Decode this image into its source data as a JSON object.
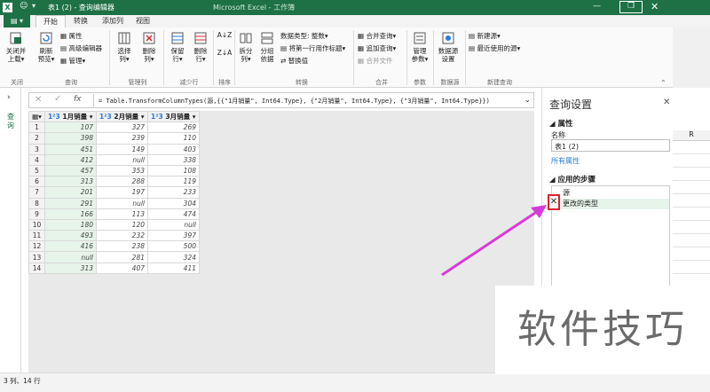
{
  "window": {
    "title": "表1 (2) - 查询编辑器",
    "excel_title": "Microsoft Excel - 工作簿"
  },
  "file_tab": "▾",
  "tabs": [
    "开始",
    "转换",
    "添加列",
    "视图"
  ],
  "ribbon": {
    "close_label": "关闭并\n上载▾",
    "refresh_label": "刷新\n预览▾",
    "properties_label": "属性",
    "advanced_editor_label": "高级编辑器",
    "manage_label": "管理▾",
    "choose_cols_label": "选择\n列▾",
    "remove_cols_label": "删除\n列▾",
    "keep_rows_label": "保留\n行▾",
    "remove_rows_label": "删除\n行▾",
    "split_label": "拆分\n列▾",
    "group_label": "分组\n依据",
    "datatype_label": "数据类型: 整数▾",
    "first_row_label": "将第一行用作标题▾",
    "replace_label": "替换值",
    "merge_queries_label": "合并查询▾",
    "append_queries_label": "追加查询▾",
    "combine_files_label": "合并文件",
    "manage_params_label": "管理\n参数▾",
    "datasource_label": "数据源\n设置",
    "new_source_label": "新建源▾",
    "recent_source_label": "最近使用的源▾",
    "groups": [
      "关闭",
      "查询",
      "管理列",
      "减少行",
      "排序",
      "转换",
      "合并",
      "参数",
      "数据源",
      "新建查询"
    ]
  },
  "formula": "= Table.TransformColumnTypes(源,{{\"1月销量\", Int64.Type}, {\"2月销量\", Int64.Type}, {\"3月销量\", Int64.Type}})",
  "fx_label": "fx",
  "left_panel_label": "查询",
  "columns": [
    "1月销量",
    "2月销量",
    "3月销量"
  ],
  "col_type_label": "1²3",
  "rows": [
    [
      "1",
      "107",
      "327",
      "269"
    ],
    [
      "2",
      "398",
      "239",
      "110"
    ],
    [
      "3",
      "451",
      "149",
      "403"
    ],
    [
      "4",
      "412",
      "null",
      "338"
    ],
    [
      "5",
      "457",
      "353",
      "108"
    ],
    [
      "6",
      "313",
      "288",
      "119"
    ],
    [
      "7",
      "201",
      "197",
      "233"
    ],
    [
      "8",
      "291",
      "null",
      "304"
    ],
    [
      "9",
      "166",
      "113",
      "474"
    ],
    [
      "10",
      "180",
      "120",
      "null"
    ],
    [
      "11",
      "493",
      "232",
      "397"
    ],
    [
      "12",
      "416",
      "238",
      "500"
    ],
    [
      "13",
      "null",
      "281",
      "324"
    ],
    [
      "14",
      "313",
      "407",
      "411"
    ]
  ],
  "status": "3 列、14 行",
  "settings": {
    "title": "查询设置",
    "props_header": "属性",
    "name_label": "名称",
    "name_value": "表1 (2)",
    "all_props_link": "所有属性",
    "steps_header": "应用的步骤",
    "steps": [
      "源",
      "更改的类型"
    ]
  },
  "excel_col": "R",
  "watermark": "软件技巧",
  "colors": {
    "excel_green": "#1e7145",
    "highlight": "#e6f4ea",
    "arrow": "#d63ad8",
    "delete_box": "#d9232d"
  }
}
